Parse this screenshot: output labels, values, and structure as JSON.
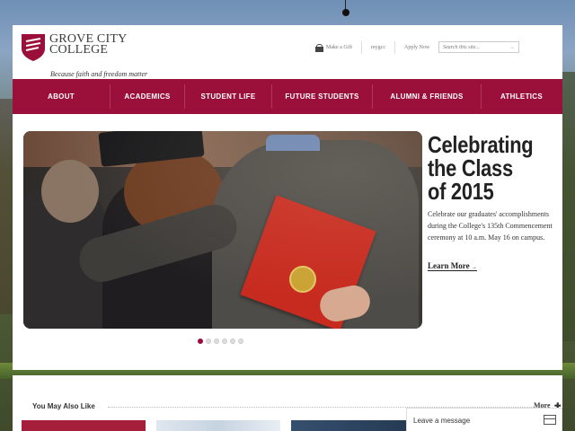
{
  "header": {
    "logo_line1": "GROVE CITY",
    "logo_line2": "COLLEGE",
    "tagline": "Because faith and freedom matter",
    "utility_links": [
      {
        "label": "Make a Gift",
        "icon": "gift-icon"
      },
      {
        "label": "mygcc"
      },
      {
        "label": "Apply Now"
      }
    ],
    "search": {
      "placeholder": "Search this site...",
      "button": "→"
    }
  },
  "nav": {
    "items": [
      "ABOUT",
      "ACADEMICS",
      "STUDENT LIFE",
      "FUTURE STUDENTS",
      "ALUMNI & FRIENDS",
      "ATHLETICS"
    ]
  },
  "hero": {
    "title": "Celebrating the Class of 2015",
    "description": "Celebrate our graduates' accomplishments during the College's 135th Commencement ceremony at 10 a.m. May 16 on campus.",
    "link": "Learn More",
    "link_arrow": "→",
    "slides_total": 6,
    "active_slide": 1
  },
  "related": {
    "heading": "You May Also Like",
    "more_label": "More",
    "more_icon": "plus-icon"
  },
  "chat": {
    "label": "Leave a message",
    "icon": "message-icon"
  },
  "colors": {
    "brand": "#9b0f3b",
    "nav_text": "#ffffff"
  }
}
